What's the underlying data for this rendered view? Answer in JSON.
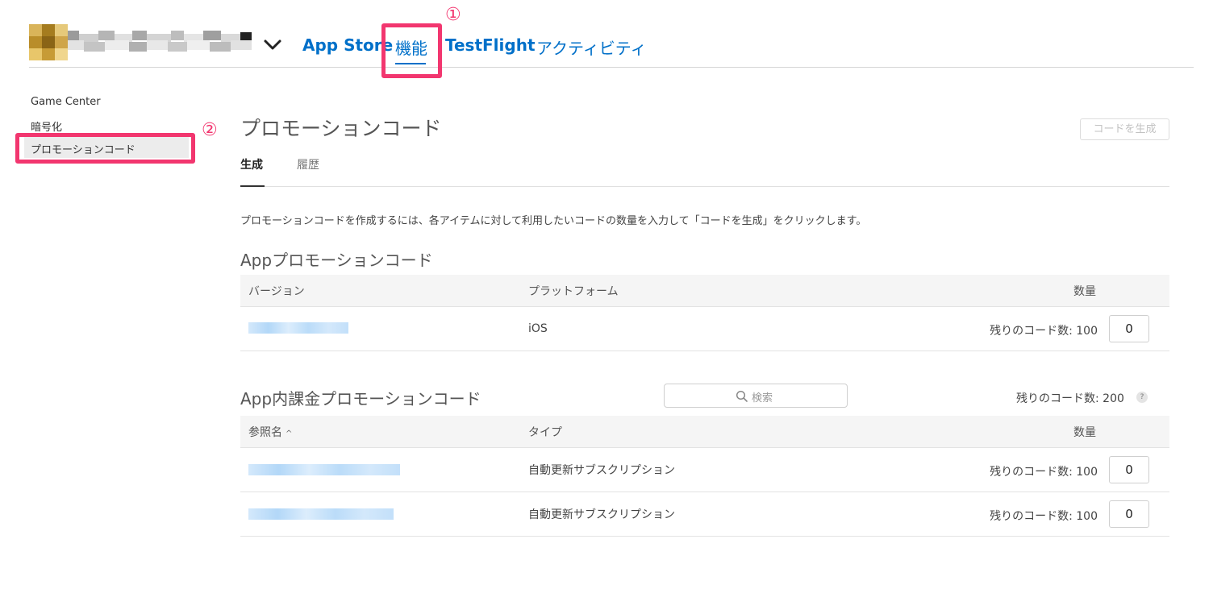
{
  "header": {
    "tabs": [
      {
        "label": "App Store"
      },
      {
        "label": "機能"
      },
      {
        "label": "TestFlight"
      },
      {
        "label": "アクティビティ"
      }
    ],
    "annotation_1": "①",
    "annotation_2": "②"
  },
  "sidebar": {
    "items": [
      {
        "label": "Game Center"
      },
      {
        "label": "暗号化"
      },
      {
        "label": "プロモーションコード"
      }
    ]
  },
  "main": {
    "title": "プロモーションコード",
    "generate_button": "コードを生成",
    "subtabs": [
      {
        "label": "生成"
      },
      {
        "label": "履歴"
      }
    ],
    "description": "プロモーションコードを作成するには、各アイテムに対して利用したいコードの数量を入力して「コードを生成」をクリックします。",
    "app_section": {
      "title": "Appプロモーションコード",
      "columns": [
        "バージョン",
        "プラットフォーム",
        "数量"
      ],
      "rows": [
        {
          "platform": "iOS",
          "remaining": "残りのコード数: 100",
          "quantity": "0"
        }
      ]
    },
    "iap_section": {
      "title": "App内課金プロモーションコード",
      "search_placeholder": "検索",
      "total_remaining": "残りのコード数: 200",
      "help": "?",
      "columns": [
        "参照名",
        "タイプ",
        "数量"
      ],
      "sort_indicator": "^",
      "rows": [
        {
          "type": "自動更新サブスクリプション",
          "remaining": "残りのコード数: 100",
          "quantity": "0"
        },
        {
          "type": "自動更新サブスクリプション",
          "remaining": "残りのコード数: 100",
          "quantity": "0"
        }
      ]
    }
  },
  "colors": {
    "accent": "#0070c9",
    "annotation": "#f2366f"
  }
}
